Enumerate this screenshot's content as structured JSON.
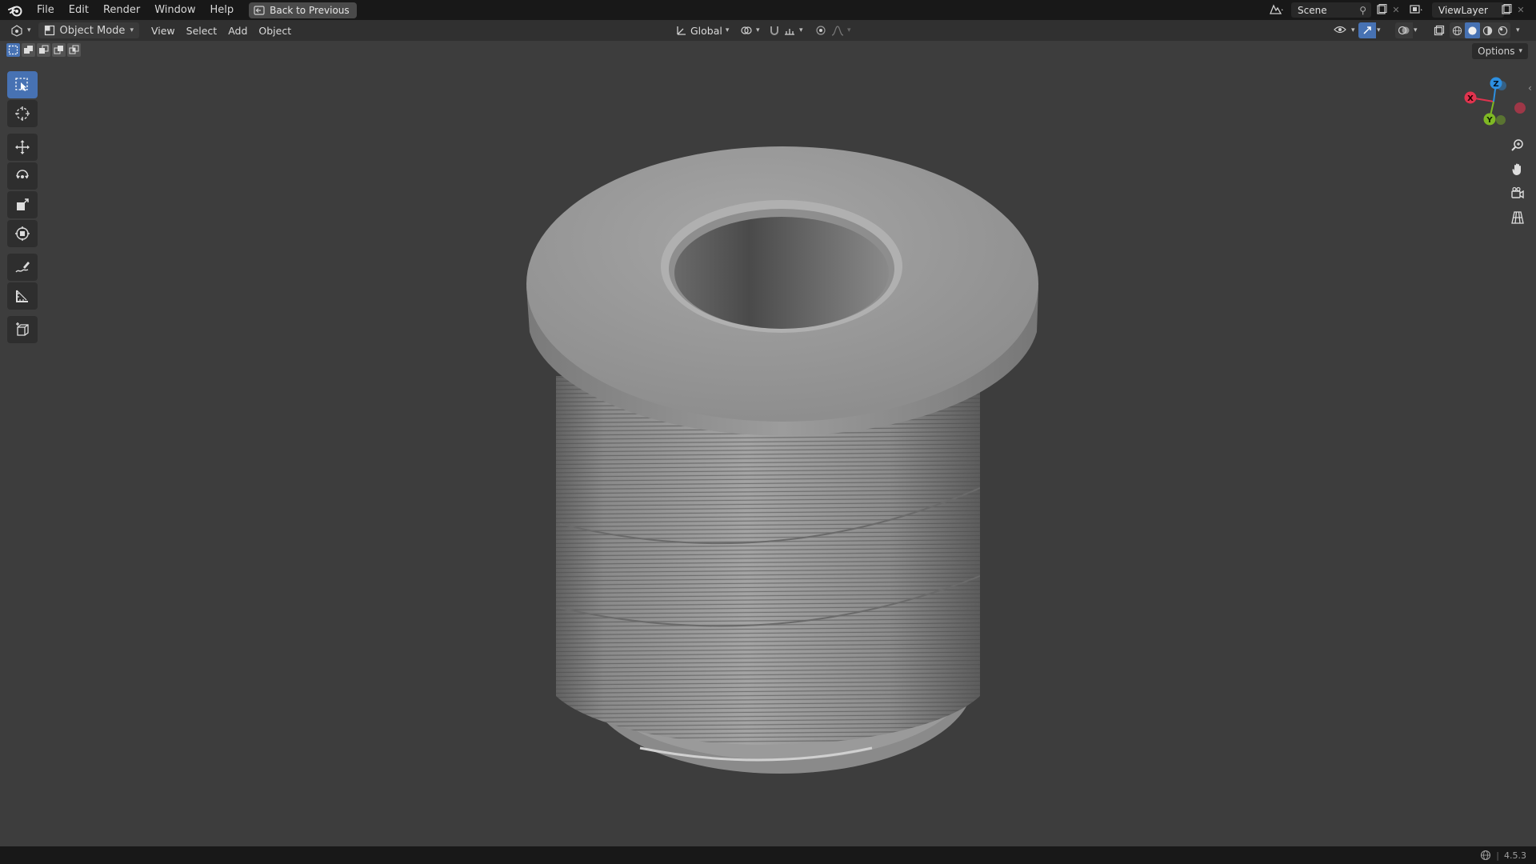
{
  "topbar": {
    "menus": [
      "File",
      "Edit",
      "Render",
      "Window",
      "Help"
    ],
    "back_button": "Back to Previous",
    "scene_name": "Scene",
    "view_layer_name": "ViewLayer"
  },
  "header": {
    "mode": "Object Mode",
    "menus": [
      "View",
      "Select",
      "Add",
      "Object"
    ],
    "transform_orientation": "Global"
  },
  "viewport": {
    "options_label": "Options",
    "gizmo_axes": [
      "X",
      "Y",
      "Z"
    ]
  },
  "toolbar": {
    "tools": [
      "select-box",
      "cursor",
      "move",
      "rotate",
      "scale",
      "transform",
      "annotate",
      "measure",
      "add-cube"
    ],
    "active_tool": "select-box"
  },
  "statusbar": {
    "version": "4.5.3"
  },
  "colors": {
    "accent": "#4772b3",
    "axis_x": "#e0334e",
    "axis_y": "#7fb824",
    "axis_z": "#2d8fe1",
    "viewport_bg": "#3d3d3d"
  }
}
